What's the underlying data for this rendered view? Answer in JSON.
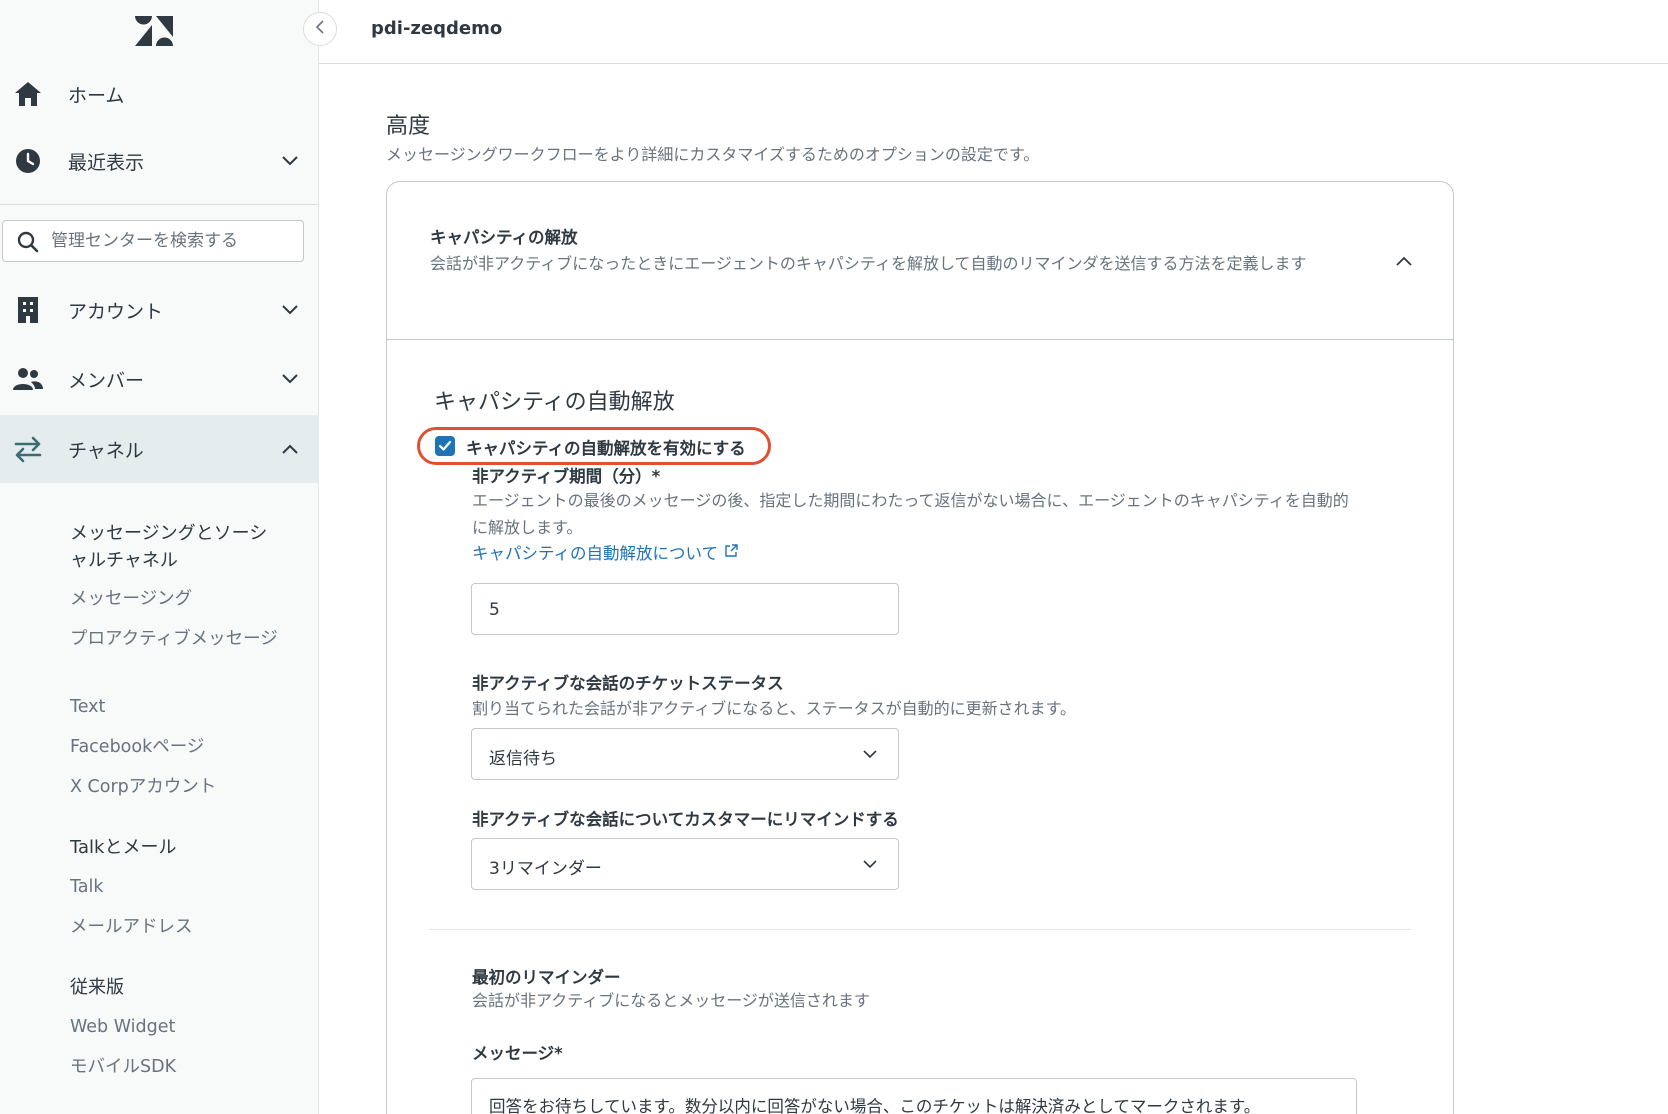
{
  "topbar": {
    "org_name": "pdi-zeqdemo"
  },
  "sidebar": {
    "home_label": "ホーム",
    "recent_label": "最近表示",
    "search_placeholder": "管理センターを検索する",
    "account_label": "アカウント",
    "members_label": "メンバー",
    "channels_label": "チャネル",
    "groups": [
      {
        "heading": "メッセージングとソーシャルチャネル",
        "items": [
          "メッセージング",
          "プロアクティブメッセージ",
          "Text",
          "Facebookページ",
          "X Corpアカウント"
        ]
      },
      {
        "heading": "Talkとメール",
        "items": [
          "Talk",
          "メールアドレス"
        ]
      },
      {
        "heading": "従来版",
        "items": [
          "Web Widget",
          "モバイルSDK"
        ]
      }
    ]
  },
  "main": {
    "section_title": "高度",
    "section_desc": "メッセージングワークフローをより詳細にカスタマイズするためのオプションの設定です。",
    "card": {
      "title": "キャパシティの解放",
      "desc": "会話が非アクティブになったときにエージェントのキャパシティを解放して自動のリマインダを送信する方法を定義します",
      "sub_title": "キャパシティの自動解放",
      "checkbox_label": "キャパシティの自動解放を有効にする",
      "checkbox_checked": true,
      "inactive_period": {
        "label": "非アクティブ期間（分）*",
        "hint": "エージェントの最後のメッセージの後、指定した期間にわたって返信がない場合に、エージェントのキャパシティを自動的に解放します。",
        "link": "キャパシティの自動解放について",
        "value": "5"
      },
      "ticket_status": {
        "label": "非アクティブな会話のチケットステータス",
        "hint": "割り当てられた会話が非アクティブになると、ステータスが自動的に更新されます。",
        "value": "返信待ち"
      },
      "remind": {
        "label": "非アクティブな会話についてカスタマーにリマインドする",
        "value": "3リマインダー"
      },
      "first_reminder": {
        "label": "最初のリマインダー",
        "hint": "会話が非アクティブになるとメッセージが送信されます"
      },
      "message": {
        "label": "メッセージ*",
        "value": "回答をお待ちしています。数分以内に回答がない場合、このチケットは解決済みとしてマークされます。"
      }
    }
  },
  "colors": {
    "accent": "#1f73b7",
    "highlight": "#e34f32",
    "active_bg": "#e4ecee"
  },
  "icons": [
    "zendesk-logo",
    "chevron-left-icon",
    "home-icon",
    "clock-icon",
    "search-icon",
    "building-icon",
    "people-icon",
    "swap-arrows-icon",
    "chevron-down-icon",
    "chevron-up-icon",
    "check-icon",
    "external-link-icon"
  ]
}
